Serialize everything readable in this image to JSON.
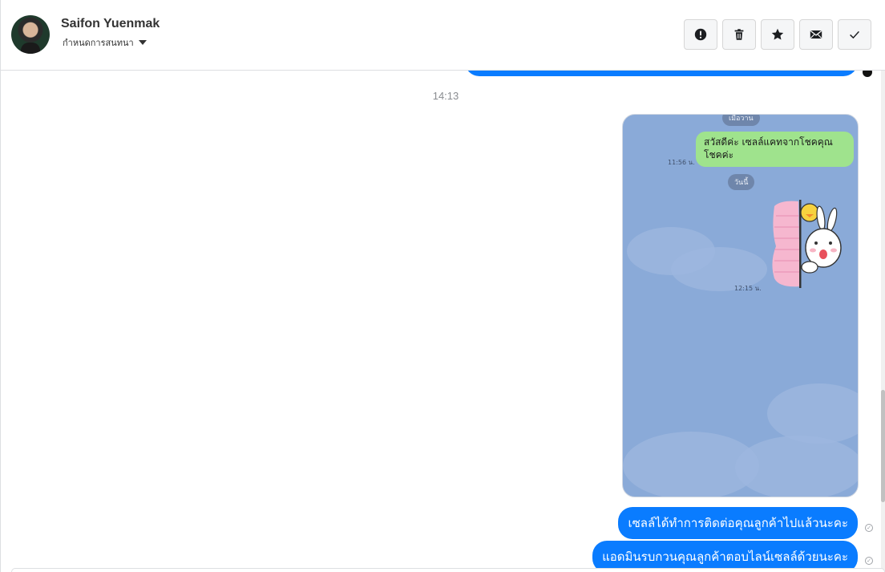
{
  "header": {
    "contact_name": "Saifon Yuenmak",
    "contact_action": "กำหนดการสนทนา",
    "toolbar": {
      "spam": "exclamation-circle-icon",
      "delete": "trash-icon",
      "star": "star-icon",
      "mail": "envelope-icon",
      "done": "check-icon"
    }
  },
  "chat": {
    "timestamp": "14:13",
    "image_message": {
      "pill_top": "เมื่อวาน",
      "bubble_text": "สวัสดีค่ะ เซลล์แคทจากโชคคุณโชคค่ะ",
      "bubble_time": "11:56 น.",
      "pill_today": "วันนี้",
      "sticker_time": "12:15 น."
    },
    "messages": [
      {
        "text": "เซลล์ได้ทำการติดต่อคุณลูกค้าไปแล้วนะคะ"
      },
      {
        "text": "แอดมินรบกวนคุณลูกค้าตอบไลน์เซลล์ด้วยนะคะ"
      }
    ]
  },
  "colors": {
    "bubble_blue": "#0a7cff",
    "line_green": "#9fe38d",
    "screenshot_bg": "#8aaad8"
  }
}
